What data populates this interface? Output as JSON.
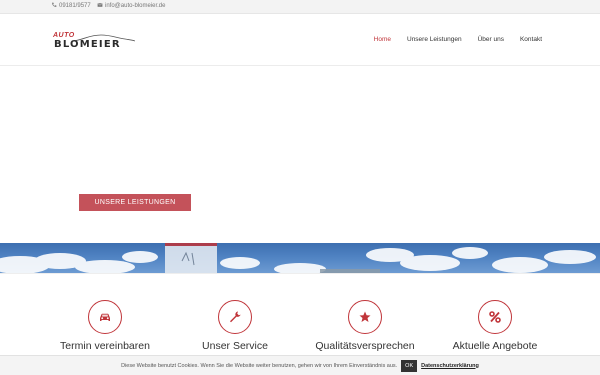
{
  "topbar": {
    "phone": "09181/9577",
    "email": "info@auto-blomeier.de"
  },
  "header": {
    "logo_top": "AUTO",
    "logo_name": "BLOMEIER",
    "nav": [
      {
        "label": "Home",
        "active": true
      },
      {
        "label": "Unsere Leistungen",
        "active": false
      },
      {
        "label": "Über uns",
        "active": false
      },
      {
        "label": "Kontakt",
        "active": false
      }
    ]
  },
  "hero": {
    "button_label": "UNSERE LEISTUNGEN"
  },
  "services": [
    {
      "title": "Termin vereinbaren",
      "icon": "car-icon"
    },
    {
      "title": "Unser Service",
      "icon": "wrench-icon"
    },
    {
      "title": "Qualitätsversprechen",
      "icon": "star-icon"
    },
    {
      "title": "Aktuelle Angebote",
      "icon": "percent-icon"
    }
  ],
  "cookie": {
    "message": "Diese Website benutzt Cookies. Wenn Sie die Website weiter benutzen, gehen wir von Ihrem Einverständnis aus.",
    "ok_label": "OK",
    "policy_label": "Datenschutzerklärung"
  },
  "colors": {
    "accent": "#c0353a",
    "button": "#c4525a",
    "sky": "#4f82c2"
  }
}
